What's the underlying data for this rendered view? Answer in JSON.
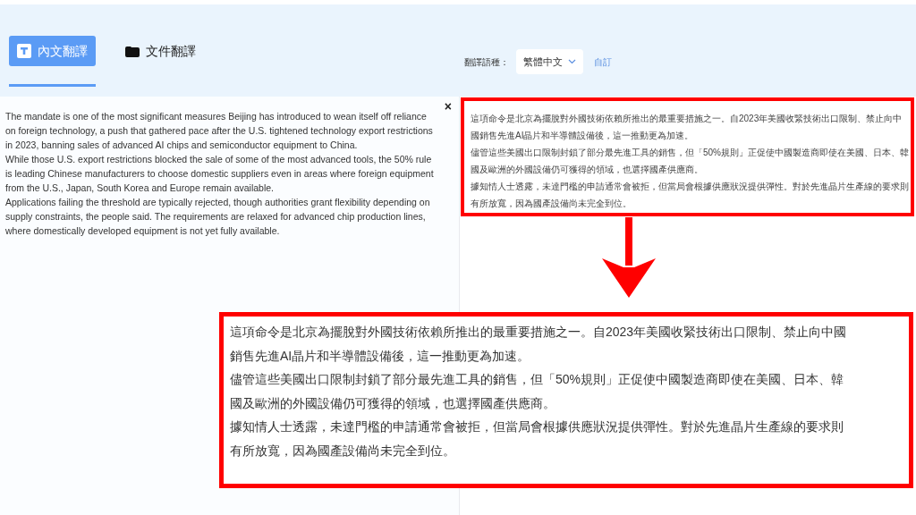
{
  "tabs": [
    {
      "label": "內文翻譯",
      "kind": "text",
      "selected": true
    },
    {
      "label": "文件翻譯",
      "kind": "folder",
      "selected": false
    }
  ],
  "language": {
    "label": "翻譯語種：",
    "value": "繁體中文",
    "custom_link": "自訂"
  },
  "source": {
    "close": "×",
    "paragraphs": [
      "The mandate is one of the most significant measures Beijing has introduced to wean itself off reliance on foreign technology, a push that gathered pace after the U.S. tightened technology export restrictions in 2023, banning sales of advanced AI chips and semiconductor equipment to China.",
      "While those U.S. export restrictions blocked the sale of some of the most advanced tools, the 50% rule is leading Chinese manufacturers to choose domestic suppliers even in areas where foreign equipment from the U.S., Japan, South Korea and Europe remain available.",
      "Applications failing the threshold are typically rejected, though authorities grant flexibility depending on supply constraints, the people said. The requirements are relaxed for advanced chip production lines, where domestically developed equipment is not yet fully available."
    ]
  },
  "translation": {
    "paragraphs": [
      "這項命令是北京為擺脫對外國技術依賴所推出的最重要措施之一。自2023年美國收緊技術出口限制、禁止向中國銷售先進AI晶片和半導體設備後，這一推動更為加速。",
      "儘管這些美國出口限制封鎖了部分最先進工具的銷售，但「50%規則」正促使中國製造商即使在美國、日本、韓國及歐洲的外國設備仍可獲得的領域，也選擇國產供應商。",
      "據知情人士透露，未達門檻的申請通常會被拒，但當局會根據供應狀況提供彈性。對於先進晶片生產線的要求則有所放寬，因為國產設備尚未完全到位。"
    ]
  },
  "zoom_inset": {
    "paragraphs": [
      "這項命令是北京為擺脫對外國技術依賴所推出的最重要措施之一。自2023年美國收緊技術出口限制、禁止向中國銷售先進AI晶片和半導體設備後，這一推動更為加速。",
      "儘管這些美國出口限制封鎖了部分最先進工具的銷售，但「50%規則」正促使中國製造商即使在美國、日本、韓國及歐洲的外國設備仍可獲得的領域，也選擇國產供應商。",
      "據知情人士透露，未達門檻的申請通常會被拒，但當局會根據供應狀況提供彈性。對於先進晶片生產線的要求則有所放寬，因為國產設備尚未完全到位。"
    ]
  }
}
